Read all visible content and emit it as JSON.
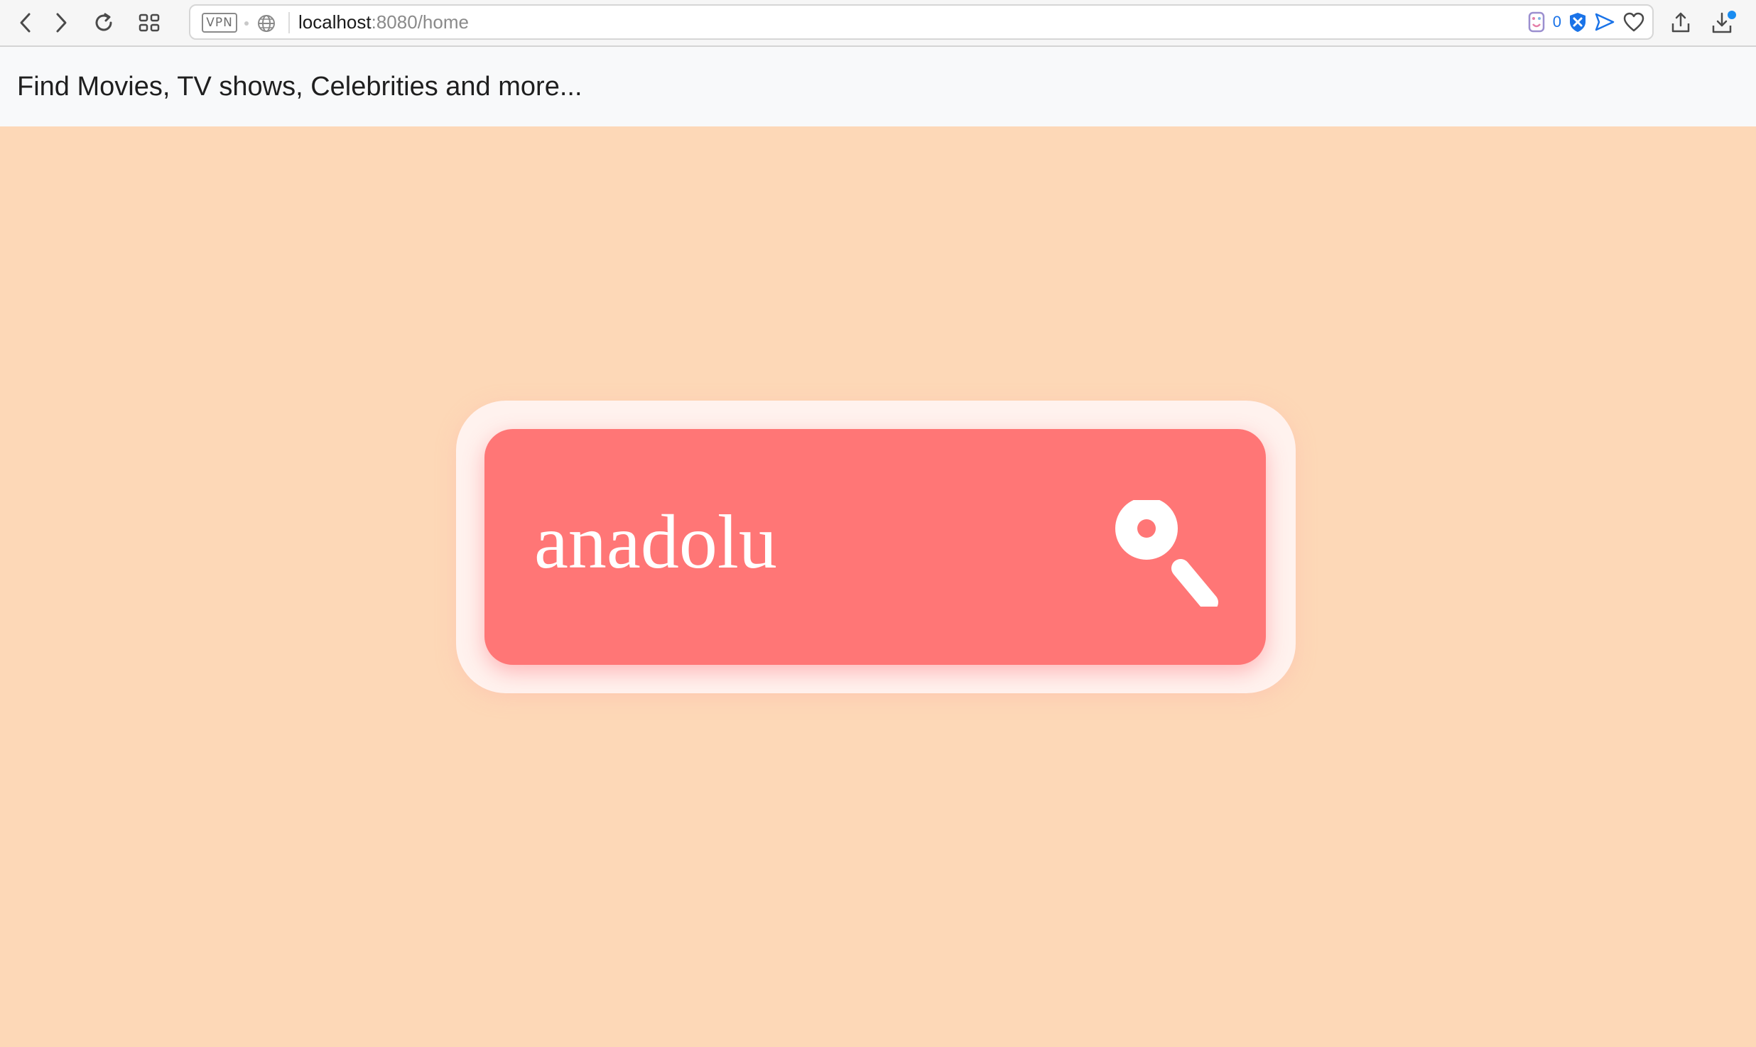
{
  "browser": {
    "url_host": "localhost",
    "url_path": ":8080/home",
    "vpn_label": "VPN",
    "shield_count": "0"
  },
  "header": {
    "brand": "Find Movies, TV shows, Celebrities and more..."
  },
  "search": {
    "value": "anadolu"
  },
  "colors": {
    "page_background": "#fdd8b7",
    "search_box": "#ff7676",
    "search_frame": "#fff2ee",
    "header_background": "#f8f9fa"
  },
  "icons": [
    "back-icon",
    "forward-icon",
    "reload-icon",
    "tabs-grid-icon",
    "globe-icon",
    "extension-icon",
    "shield-icon",
    "send-icon",
    "heart-icon",
    "share-icon",
    "download-icon",
    "search-icon"
  ]
}
